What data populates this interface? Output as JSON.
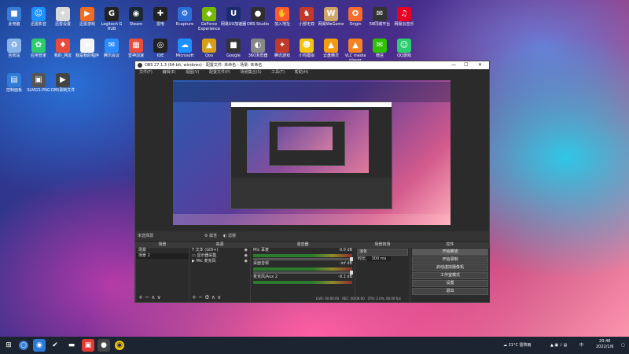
{
  "desktop": {
    "icons_row1": [
      {
        "label": "此电脑",
        "color": "#3a7bd5",
        "glyph": "■",
        "icon": "computer-icon"
      },
      {
        "label": "迅雷影音",
        "color": "#1e8fff",
        "glyph": "☺",
        "icon": "xunlei-icon"
      },
      {
        "label": "迅雷设置",
        "color": "#d9d9d9",
        "glyph": "✦",
        "icon": "xunlei-settings-icon"
      },
      {
        "label": "迅雷游戏",
        "color": "#f26d21",
        "glyph": "▶",
        "icon": "game-icon"
      },
      {
        "label": "Logitech G HUB",
        "color": "#222",
        "glyph": "G",
        "icon": "logitech-icon"
      },
      {
        "label": "Steam",
        "color": "#1b2838",
        "glyph": "◉",
        "icon": "steam-icon"
      },
      {
        "label": "雷电",
        "color": "#222",
        "glyph": "✚",
        "icon": "leidian-icon"
      },
      {
        "label": "Ecapture",
        "color": "#2b6fd6",
        "glyph": "⚙",
        "icon": "ecapture-icon"
      },
      {
        "label": "GeForce Experience",
        "color": "#76b900",
        "glyph": "◆",
        "icon": "geforce-icon"
      },
      {
        "label": "网易UU加速器",
        "color": "#1b2b6b",
        "glyph": "U",
        "icon": "uu-icon"
      },
      {
        "label": "OBS Studio",
        "color": "#302e31",
        "glyph": "●",
        "icon": "obs-icon"
      },
      {
        "label": "加入地址",
        "color": "#ff5a2d",
        "glyph": "✋",
        "icon": "hand-icon"
      },
      {
        "label": "小部无双",
        "color": "#c0392b",
        "glyph": "♞",
        "icon": "game2-icon"
      },
      {
        "label": "网易WeGame",
        "color": "#cfa56a",
        "glyph": "W",
        "icon": "wegame-icon"
      },
      {
        "label": "Origin",
        "color": "#f56c2d",
        "glyph": "O",
        "icon": "origin-icon"
      },
      {
        "label": "58同城平台",
        "color": "#333",
        "glyph": "✉",
        "icon": "platform-icon"
      },
      {
        "label": "网易云音乐",
        "color": "#e60026",
        "glyph": "♫",
        "icon": "music-icon"
      }
    ],
    "icons_row2": [
      {
        "label": "回收站",
        "color": "#8ab4e8",
        "glyph": "♻",
        "icon": "recycle-bin-icon"
      },
      {
        "label": "应用管家",
        "color": "#2ecc71",
        "glyph": "✿",
        "icon": "app-manager-icon"
      },
      {
        "label": "我的_网友",
        "color": "#e84b3c",
        "glyph": "♦",
        "icon": "game3-icon"
      },
      {
        "label": "我是我的程序",
        "color": "#f5f5f5",
        "glyph": "✈",
        "icon": "plane-icon"
      },
      {
        "label": "腾讯会议",
        "color": "#2b8cff",
        "glyph": "✉",
        "icon": "discord-icon"
      },
      {
        "label": "雷神加速",
        "color": "#e74c3c",
        "glyph": "▦",
        "icon": "thunder-icon"
      },
      {
        "label": "IDE",
        "color": "#222",
        "glyph": "◎",
        "icon": "ide-icon"
      },
      {
        "label": "Microsoft",
        "color": "#1e90ff",
        "glyph": "☁",
        "icon": "cloud-icon"
      },
      {
        "label": "Qoo",
        "color": "#d5a018",
        "glyph": "▲",
        "icon": "qoo-icon"
      },
      {
        "label": "Google",
        "color": "#333",
        "glyph": "■",
        "icon": "app-icon"
      },
      {
        "label": "360浏览器",
        "color": "#888",
        "glyph": "◐",
        "icon": "browser-icon"
      },
      {
        "label": "腾讯游戏",
        "color": "#c0392b",
        "glyph": "✦",
        "icon": "game4-icon"
      },
      {
        "label": "小鸡模拟",
        "color": "#f1c40f",
        "glyph": "☻",
        "icon": "chick-icon"
      },
      {
        "label": "云盘精灵",
        "color": "#f39c12",
        "glyph": "▲",
        "icon": "cloud-disk-icon"
      },
      {
        "label": "VLC media player",
        "color": "#f58220",
        "glyph": "▲",
        "icon": "vlc-icon"
      },
      {
        "label": "微信",
        "color": "#2dc100",
        "glyph": "✉",
        "icon": "wechat-icon"
      },
      {
        "label": "QQ游戏",
        "color": "#2ecc71",
        "glyph": "☺",
        "icon": "qq-icon"
      }
    ],
    "icons_row3": [
      {
        "label": "控制面板",
        "color": "#2f7bd6",
        "glyph": "▤",
        "icon": "control-panel-icon"
      },
      {
        "label": "SLMGS.PNG",
        "color": "#555",
        "glyph": "▣",
        "icon": "image-file-icon"
      },
      {
        "label": "OBS录制文件",
        "color": "#444",
        "glyph": "▶",
        "icon": "video-file-icon"
      }
    ]
  },
  "obs": {
    "title": "OBS 27.1.3 (64-bit, windows) - 配置文件: 未命名 - 场景: 未命名",
    "menu": [
      "文件(F)",
      "编辑(E)",
      "视图(V)",
      "配置文件(P)",
      "场景集合(S)",
      "工具(T)",
      "帮助(H)"
    ],
    "source_bar": {
      "label": "未选择源",
      "props": "属性",
      "filters": "滤镜"
    },
    "scenes": {
      "title": "场景",
      "items": [
        "场景",
        "场景 2"
      ]
    },
    "sources": {
      "title": "来源",
      "items": [
        "文本 (GDI+)",
        "显示器采集",
        "Mic 麦克风"
      ]
    },
    "mixer": {
      "title": "混音器",
      "tracks": [
        {
          "name": "Mic 耳麦",
          "db": "0.0 dB",
          "level": 0.62
        },
        {
          "name": "桌面音频",
          "db": "-inf dB",
          "level": 0.3
        },
        {
          "name": "麦克风/Aux 2",
          "db": "-9.1 dB",
          "level": 0.5
        }
      ]
    },
    "transitions": {
      "title": "场景转场",
      "type": "淡化",
      "duration_label": "时长",
      "duration": "300 ms"
    },
    "controls": {
      "title": "控件",
      "buttons": [
        "开始推流",
        "开始录制",
        "启动虚拟摄像机",
        "工作室模式",
        "设置",
        "退出"
      ]
    },
    "status": {
      "live": "LIVE: 00:00:00",
      "rec": "REC: 00:00:00",
      "cpu": "CPU: 2.0%, 60.00 fps"
    }
  },
  "taskbar": {
    "weather": "21°C 雷阵雨",
    "lang": "中",
    "time": "20:46",
    "date": "2022/1/6"
  }
}
